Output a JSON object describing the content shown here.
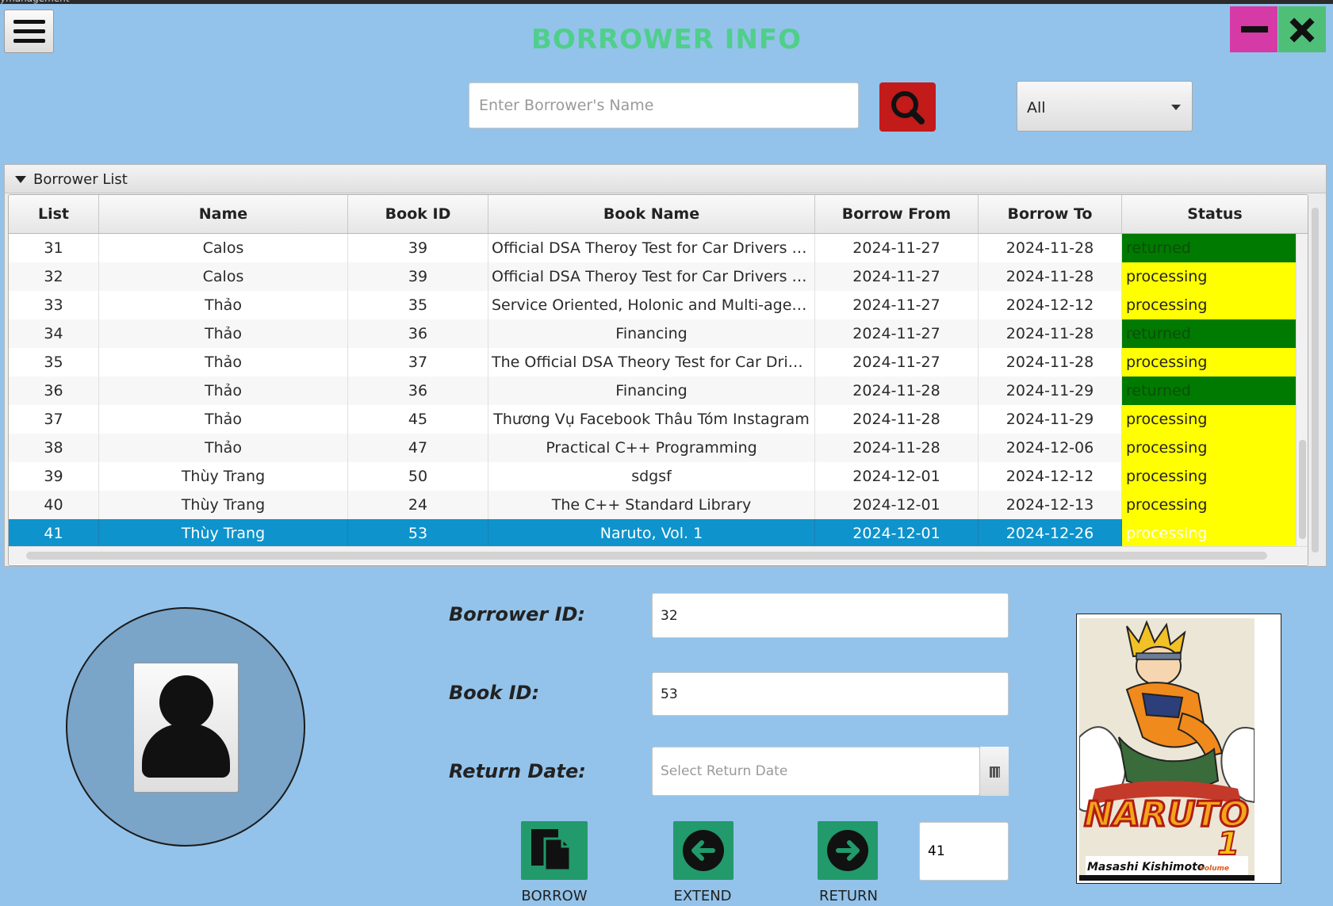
{
  "window": {
    "title_fragment": "ymanagement"
  },
  "header": {
    "title": "BORROWER INFO"
  },
  "search": {
    "placeholder": "Enter Borrower's Name",
    "filter_value": "All"
  },
  "panel": {
    "title": "Borrower List"
  },
  "table": {
    "columns": [
      "List",
      "Name",
      "Book ID",
      "Book Name",
      "Borrow From",
      "Borrow To",
      "Status"
    ],
    "rows": [
      {
        "list": "31",
        "name": "Calos",
        "book_id": "39",
        "book_name": "Official DSA Theroy Test for Car Drivers and the Highway Code",
        "from": "2024-11-27",
        "to": "2024-11-28",
        "status": "returned"
      },
      {
        "list": "32",
        "name": "Calos",
        "book_id": "39",
        "book_name": "Official DSA Theroy Test for Car Drivers and the Highway Code",
        "from": "2024-11-27",
        "to": "2024-11-28",
        "status": "processing"
      },
      {
        "list": "33",
        "name": "Thảo",
        "book_id": "35",
        "book_name": "Service Oriented, Holonic and Multi-agent Manufacturing",
        "from": "2024-11-27",
        "to": "2024-12-12",
        "status": "processing"
      },
      {
        "list": "34",
        "name": "Thảo",
        "book_id": "36",
        "book_name": "Financing",
        "from": "2024-11-27",
        "to": "2024-11-28",
        "status": "returned"
      },
      {
        "list": "35",
        "name": "Thảo",
        "book_id": "37",
        "book_name": "The Official DSA Theory Test for Car Drivers",
        "from": "2024-11-27",
        "to": "2024-11-28",
        "status": "processing"
      },
      {
        "list": "36",
        "name": "Thảo",
        "book_id": "36",
        "book_name": "Financing",
        "from": "2024-11-28",
        "to": "2024-11-29",
        "status": "returned"
      },
      {
        "list": "37",
        "name": "Thảo",
        "book_id": "45",
        "book_name": "Thương Vụ Facebook Thâu Tóm Instagram",
        "from": "2024-11-28",
        "to": "2024-11-29",
        "status": "processing"
      },
      {
        "list": "38",
        "name": "Thảo",
        "book_id": "47",
        "book_name": "Practical C++ Programming",
        "from": "2024-11-28",
        "to": "2024-12-06",
        "status": "processing"
      },
      {
        "list": "39",
        "name": "Thùy Trang",
        "book_id": "50",
        "book_name": "sdgsf",
        "from": "2024-12-01",
        "to": "2024-12-12",
        "status": "processing"
      },
      {
        "list": "40",
        "name": "Thùy Trang",
        "book_id": "24",
        "book_name": "The C++ Standard Library",
        "from": "2024-12-01",
        "to": "2024-12-13",
        "status": "processing"
      },
      {
        "list": "41",
        "name": "Thùy Trang",
        "book_id": "53",
        "book_name": "Naruto, Vol. 1",
        "from": "2024-12-01",
        "to": "2024-12-26",
        "status": "processing"
      }
    ],
    "selected_list": "41",
    "status_colors": {
      "returned": "#007a00",
      "processing": "#ffff00"
    }
  },
  "form": {
    "borrower_id_label": "Borrower ID:",
    "borrower_id_value": "32",
    "book_id_label": "Book ID:",
    "book_id_value": "53",
    "return_date_label": "Return Date:",
    "return_date_placeholder": "Select Return Date",
    "selected_list_value": "41"
  },
  "actions": {
    "borrow": "BORROW",
    "extend": "EXTEND",
    "return": "RETURN"
  },
  "cover": {
    "title": "NARUTO",
    "volume": "1",
    "author": "Masashi Kishimoto",
    "volume_word": "volume"
  },
  "icons": [
    "menu-icon",
    "minimize-icon",
    "close-icon",
    "search-icon",
    "chevron-down-icon",
    "calendar-icon",
    "user-icon",
    "borrow-icon",
    "arrow-left-icon",
    "arrow-right-icon"
  ],
  "colors": {
    "background": "#93c3ea",
    "title": "#4fcf8a",
    "search_button": "#c31a1a",
    "action_button": "#229a6b",
    "selection": "#0e93cc"
  }
}
